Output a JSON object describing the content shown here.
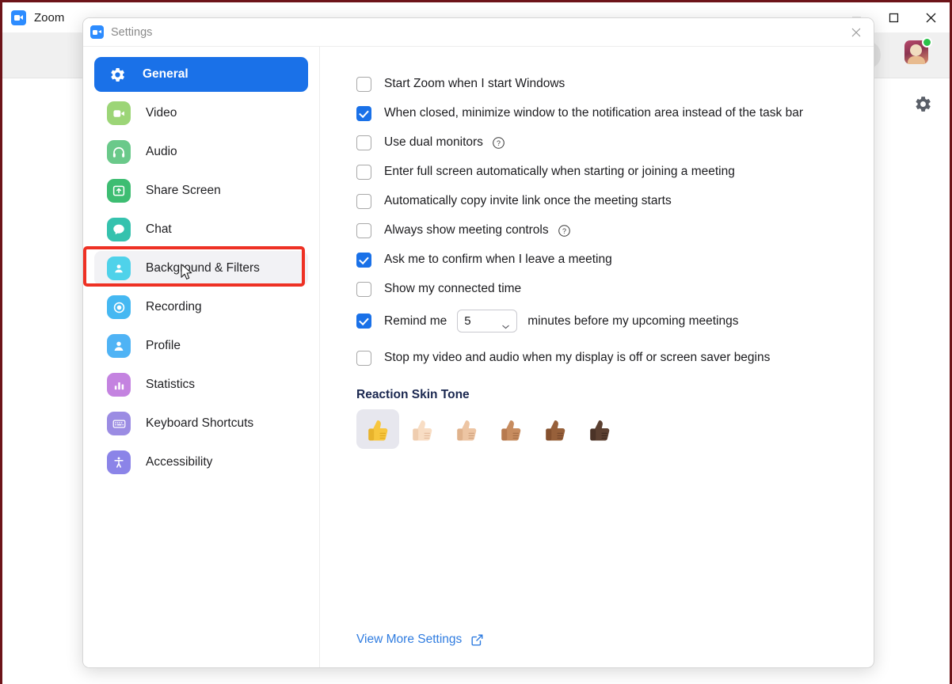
{
  "desktop": {
    "frame_color": "#6d1419"
  },
  "zoom_window": {
    "app_title": "Zoom",
    "logo_icon": "zoom-camera-icon",
    "controls": [
      {
        "name": "minimize",
        "icon": "minimize-icon"
      },
      {
        "name": "maximize",
        "icon": "maximize-icon"
      },
      {
        "name": "close",
        "icon": "close-icon"
      }
    ],
    "gear_icon": "gear-icon",
    "avatar_icon": "user-avatar",
    "presence": "online"
  },
  "settings": {
    "title": "Settings",
    "logo_icon": "zoom-camera-icon",
    "close_icon": "close-icon",
    "sidebar": {
      "items": [
        {
          "label": "General",
          "icon": "gear-icon",
          "active": true,
          "hovered": false,
          "icon_class": ""
        },
        {
          "label": "Video",
          "icon": "video-icon",
          "active": false,
          "hovered": false,
          "icon_class": "ic-video"
        },
        {
          "label": "Audio",
          "icon": "headset-icon",
          "active": false,
          "hovered": false,
          "icon_class": "ic-audio"
        },
        {
          "label": "Share Screen",
          "icon": "share-screen-icon",
          "active": false,
          "hovered": false,
          "icon_class": "ic-share"
        },
        {
          "label": "Chat",
          "icon": "chat-bubble-icon",
          "active": false,
          "hovered": false,
          "icon_class": "ic-chat"
        },
        {
          "label": "Background & Filters",
          "icon": "person-frame-icon",
          "active": false,
          "hovered": true,
          "icon_class": "ic-bg"
        },
        {
          "label": "Recording",
          "icon": "record-circle-icon",
          "active": false,
          "hovered": false,
          "icon_class": "ic-recording"
        },
        {
          "label": "Profile",
          "icon": "person-icon",
          "active": false,
          "hovered": false,
          "icon_class": "ic-profile"
        },
        {
          "label": "Statistics",
          "icon": "bar-chart-icon",
          "active": false,
          "hovered": false,
          "icon_class": "ic-stats"
        },
        {
          "label": "Keyboard Shortcuts",
          "icon": "keyboard-icon",
          "active": false,
          "hovered": false,
          "icon_class": "ic-keyboard"
        },
        {
          "label": "Accessibility",
          "icon": "accessibility-icon",
          "active": false,
          "hovered": false,
          "icon_class": "ic-access"
        }
      ]
    },
    "general": {
      "options": [
        {
          "label": "Start Zoom when I start Windows",
          "checked": false,
          "help": false
        },
        {
          "label": "When closed, minimize window to the notification area instead of the task bar",
          "checked": true,
          "help": false
        },
        {
          "label": "Use dual monitors",
          "checked": false,
          "help": true
        },
        {
          "label": "Enter full screen automatically when starting or joining a meeting",
          "checked": false,
          "help": false
        },
        {
          "label": "Automatically copy invite link once the meeting starts",
          "checked": false,
          "help": false
        },
        {
          "label": "Always show meeting controls",
          "checked": false,
          "help": true
        },
        {
          "label": "Ask me to confirm when I leave a meeting",
          "checked": true,
          "help": false
        },
        {
          "label": "Show my connected time",
          "checked": false,
          "help": false
        }
      ],
      "remind": {
        "checked": true,
        "prefix_label": "Remind me",
        "selected_value": "5",
        "suffix_label": "minutes before my upcoming meetings",
        "chevron_icon": "chevron-down-icon"
      },
      "stop_video": {
        "label": "Stop my video and audio when my display is off or screen saver begins",
        "checked": false
      },
      "skin_tone": {
        "heading": "Reaction Skin Tone",
        "icon_name": "thumbs-up-icon",
        "tones": [
          {
            "name": "default-yellow",
            "color": "#f7c63e",
            "shade": "#e0a91f",
            "selected": true
          },
          {
            "name": "light",
            "color": "#f7dbc3",
            "shade": "#eec5a3",
            "selected": false
          },
          {
            "name": "medium-light",
            "color": "#eec3a2",
            "shade": "#dba komp",
            "selected": false
          },
          {
            "name": "medium",
            "color": "#c68a५f",
            "shade": "#ac724a",
            "selected": false
          },
          {
            "name": "medium-dark",
            "color": "#9a6239",
            "shade": "#7f4e2b",
            "selected": false
          },
          {
            "name": "dark",
            "color": "#5d4132",
            "shade": "#473024",
            "selected": false
          }
        ]
      },
      "view_more": {
        "label": "View More Settings",
        "icon": "external-link-icon"
      }
    }
  }
}
